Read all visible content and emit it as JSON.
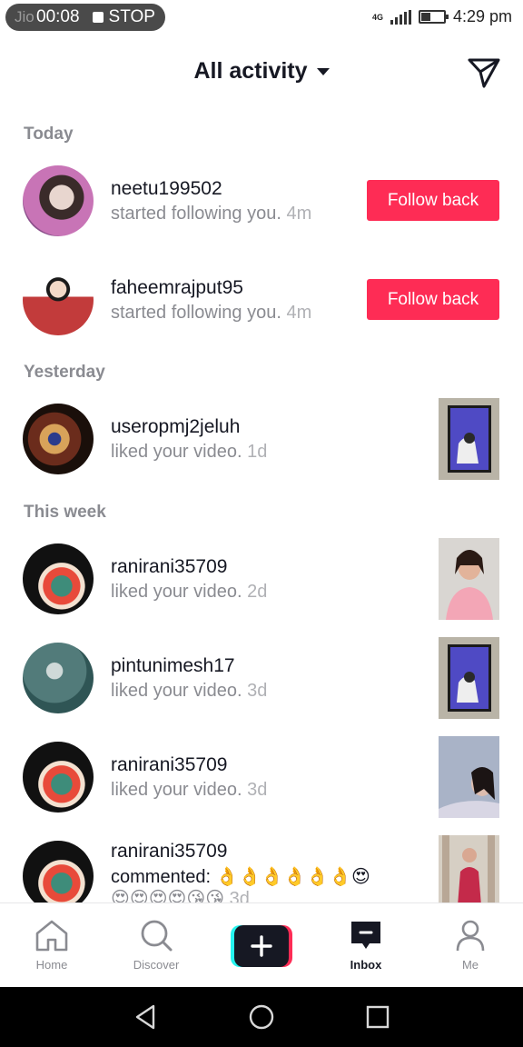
{
  "status_bar": {
    "carrier": "Jio",
    "timer": "00:08",
    "stop_label": "STOP",
    "network": "4G",
    "time": "4:29 pm"
  },
  "header": {
    "title": "All activity"
  },
  "sections": {
    "today": "Today",
    "yesterday": "Yesterday",
    "this_week": "This week"
  },
  "activities": [
    {
      "username": "neetu199502",
      "action": "started following you.",
      "time": "4m",
      "button": "Follow back"
    },
    {
      "username": "faheemrajput95",
      "action": "started following you.",
      "time": "4m",
      "button": "Follow back"
    },
    {
      "username": "useropmj2jeluh",
      "action": "liked your video.",
      "time": "1d"
    },
    {
      "username": "ranirani35709",
      "action": "liked your video.",
      "time": "2d"
    },
    {
      "username": "pintunimesh17",
      "action": "liked your video.",
      "time": "3d"
    },
    {
      "username": "ranirani35709",
      "action": "liked your video.",
      "time": "3d"
    },
    {
      "username": "ranirani35709",
      "action": "commented: 👌👌👌👌👌👌😍",
      "action2": "😍😍😍😍😘😘",
      "time": "3d"
    }
  ],
  "bottom_nav": {
    "home": "Home",
    "discover": "Discover",
    "inbox": "Inbox",
    "me": "Me"
  },
  "colors": {
    "accent": "#fe2c55",
    "text_primary": "#161823",
    "text_secondary": "#8a8b91"
  }
}
